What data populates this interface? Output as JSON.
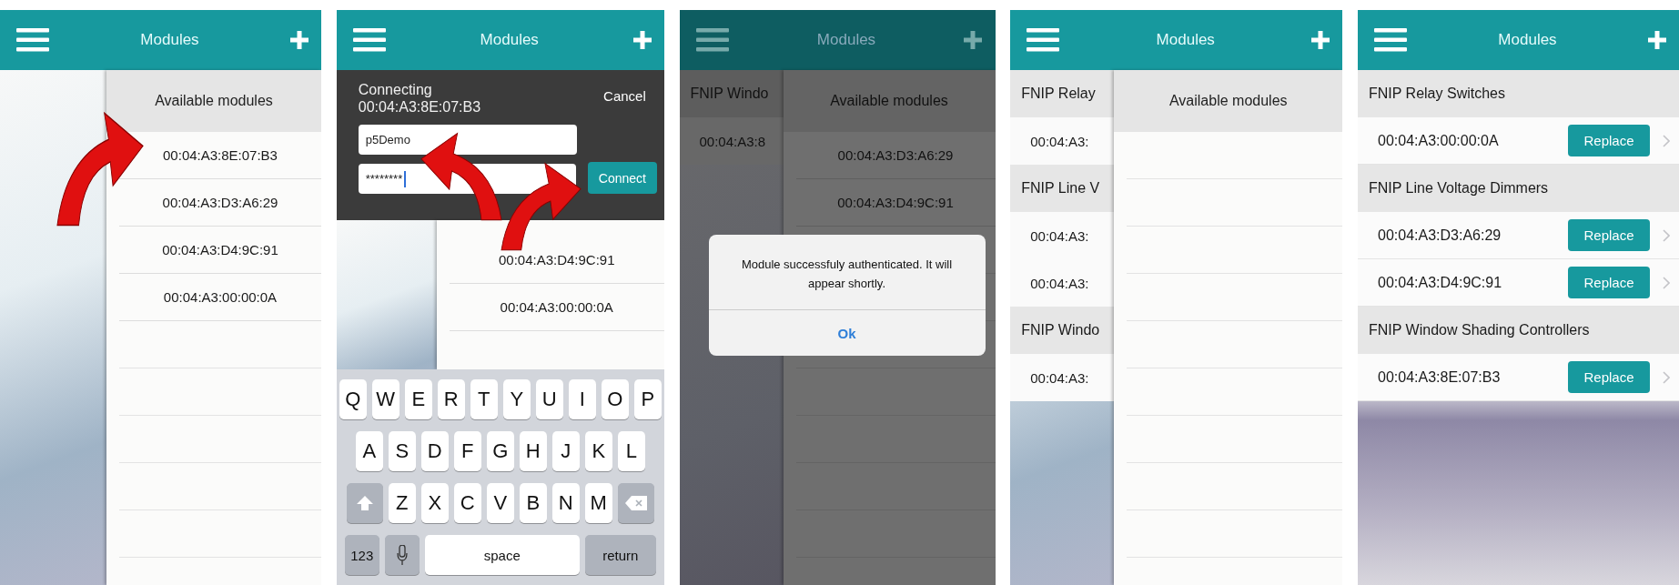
{
  "panels": [
    {
      "kind": "available",
      "title": "Modules",
      "sheet": {
        "title": "Available modules",
        "items": [
          "00:04:A3:8E:07:B3",
          "00:04:A3:D3:A6:29",
          "00:04:A3:D4:9C:91",
          "00:04:A3:00:00:0A"
        ]
      }
    },
    {
      "kind": "connecting",
      "title": "Modules",
      "sheet": {
        "items": [
          "00:04:A3:D4:9C:91",
          "00:04:A3:00:00:0A"
        ]
      },
      "connect_form": {
        "heading": "Connecting",
        "address": "00:04:A3:8E:07:B3",
        "cancel": "Cancel",
        "username": "p5Demo",
        "password": "********",
        "submit": "Connect"
      },
      "keyboard": {
        "rows": [
          [
            "Q",
            "W",
            "E",
            "R",
            "T",
            "Y",
            "U",
            "I",
            "O",
            "P"
          ],
          [
            "A",
            "S",
            "D",
            "F",
            "G",
            "H",
            "J",
            "K",
            "L"
          ],
          [
            "Z",
            "X",
            "C",
            "V",
            "B",
            "N",
            "M"
          ]
        ],
        "numbers": "123",
        "space": "space",
        "return": "return"
      }
    },
    {
      "kind": "authenticated",
      "title": "Modules",
      "background": {
        "sections": [
          {
            "title": "FNIP Windo",
            "items": [
              "00:04:A3:8"
            ]
          }
        ]
      },
      "sheet": {
        "title": "Available modules",
        "items": [
          "00:04:A3:D3:A6:29",
          "00:04:A3:D4:9C:91"
        ]
      },
      "dialog": {
        "message": "Module successfuly authenticated. It will appear shortly.",
        "button": "Ok"
      }
    },
    {
      "kind": "closing",
      "title": "Modules",
      "background": {
        "sections": [
          {
            "title": "FNIP Relay",
            "items": [
              "00:04:A3:"
            ]
          },
          {
            "title": "FNIP Line V",
            "items": [
              "00:04:A3:",
              "00:04:A3:"
            ]
          },
          {
            "title": "FNIP Windo",
            "items": [
              "00:04:A3:"
            ]
          }
        ]
      },
      "sheet": {
        "title": "Available modules"
      }
    },
    {
      "kind": "modules",
      "title": "Modules",
      "sections": [
        {
          "title": "FNIP Relay Switches",
          "items": [
            {
              "address": "00:04:A3:00:00:0A",
              "action": "Replace"
            }
          ]
        },
        {
          "title": "FNIP Line Voltage Dimmers",
          "items": [
            {
              "address": "00:04:A3:D3:A6:29",
              "action": "Replace"
            },
            {
              "address": "00:04:A3:D4:9C:91",
              "action": "Replace"
            }
          ]
        },
        {
          "title": "FNIP Window Shading Controllers",
          "items": [
            {
              "address": "00:04:A3:8E:07:B3",
              "action": "Replace"
            }
          ]
        }
      ]
    }
  ]
}
